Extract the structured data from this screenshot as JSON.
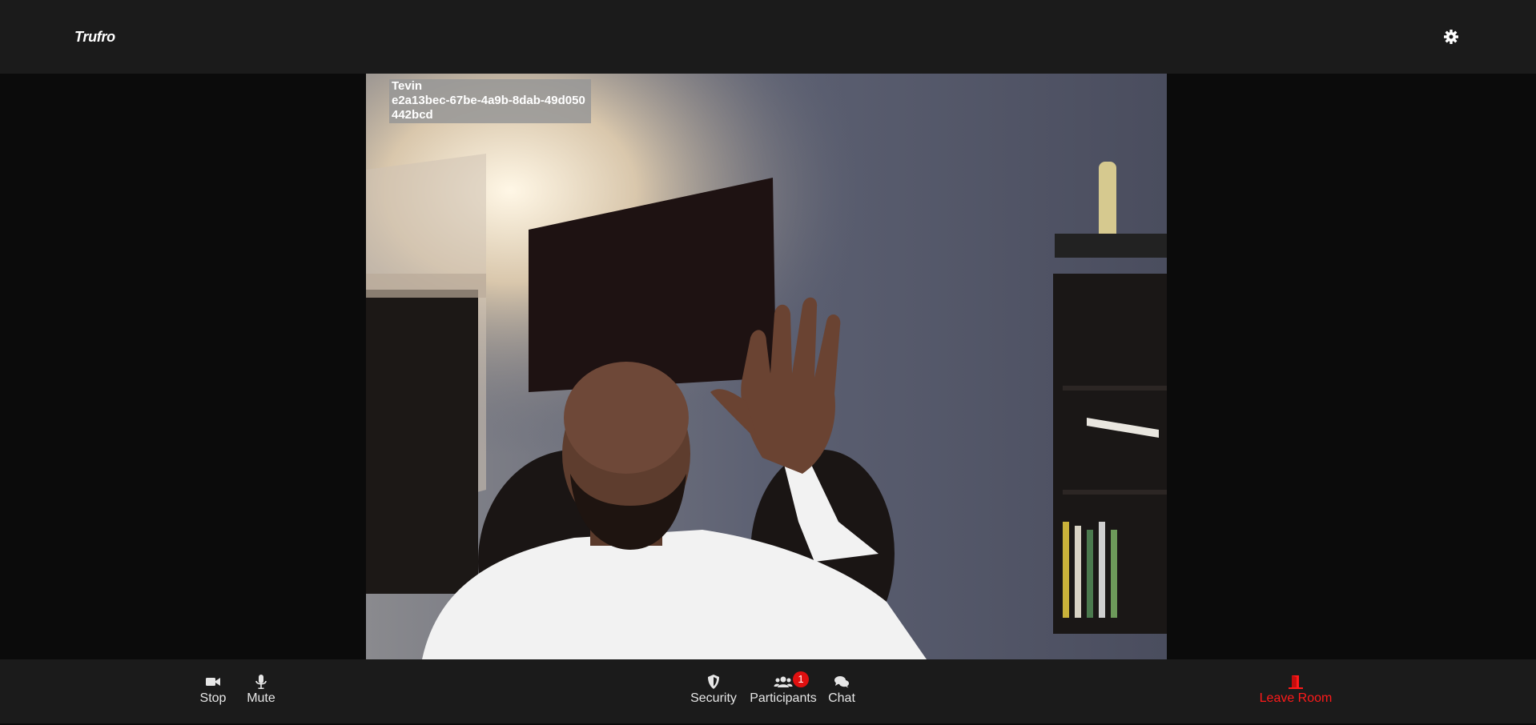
{
  "app": {
    "brand": "Trufro"
  },
  "video": {
    "participant_name": "Tevin",
    "participant_id": "e2a13bec-67be-4a9b-8dab-49d050442bcd"
  },
  "toolbar": {
    "stop_label": "Stop",
    "mute_label": "Mute",
    "security_label": "Security",
    "participants_label": "Participants",
    "participants_count": "1",
    "chat_label": "Chat",
    "leave_label": "Leave Room"
  },
  "icons": {
    "settings": "gear-icon",
    "stop": "video-camera-icon",
    "mute": "microphone-icon",
    "security": "shield-icon",
    "participants": "users-icon",
    "chat": "chat-bubbles-icon",
    "leave": "door-exit-icon"
  },
  "colors": {
    "topbar_bg": "#1b1b1b",
    "stage_bg": "#0b0b0b",
    "leave_red": "#ff1a1a",
    "badge_red": "#e01010"
  }
}
